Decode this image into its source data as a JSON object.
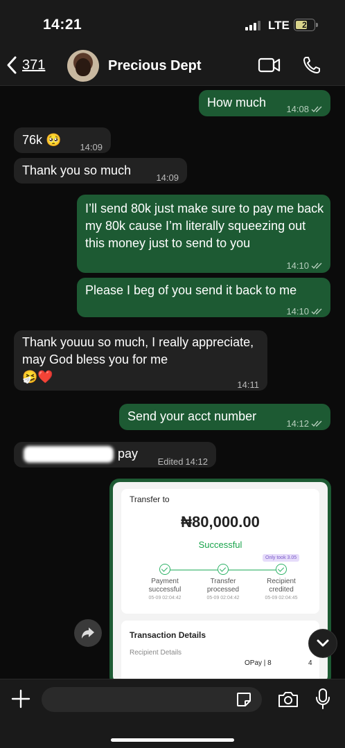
{
  "status": {
    "time": "14:21",
    "network": "LTE",
    "battery": "2"
  },
  "header": {
    "back_count": "371",
    "contact_name": "Precious Dept"
  },
  "messages": [
    {
      "text": "How much",
      "time": "14:08"
    },
    {
      "text": "76k 🥺",
      "time": "14:09"
    },
    {
      "text": "Thank you so much",
      "time": "14:09"
    },
    {
      "text": "I’ll send 80k just make sure to pay me back my 80k cause I’m literally squeezing out this money just to send to you",
      "time": "14:10"
    },
    {
      "text": "Please I beg of you send it back to me",
      "time": "14:10"
    },
    {
      "text": "Thank youuu so much, I really appreciate, may God bless you for me",
      "emoji": "🤧❤️",
      "time": "14:11"
    },
    {
      "text": "Send your acct number",
      "time": "14:12"
    },
    {
      "text": "pay",
      "edited": "Edited",
      "time": "14:12"
    }
  ],
  "receipt": {
    "title": "Transfer to",
    "amount": "₦80,000.00",
    "status": "Successful",
    "badge": "Only took 3.05",
    "steps": [
      {
        "label": "Payment successful",
        "time": "05-09 02:04:42"
      },
      {
        "label": "Transfer processed",
        "time": "05-09 02:04:42"
      },
      {
        "label": "Recipient credited",
        "time": "05-09 02:04:45"
      }
    ],
    "section": "Transaction Details",
    "recipient_label": "Recipient Details",
    "recipient_value": "OPay | 8",
    "recipient_tail": "4"
  },
  "composer": {
    "placeholder": ""
  }
}
